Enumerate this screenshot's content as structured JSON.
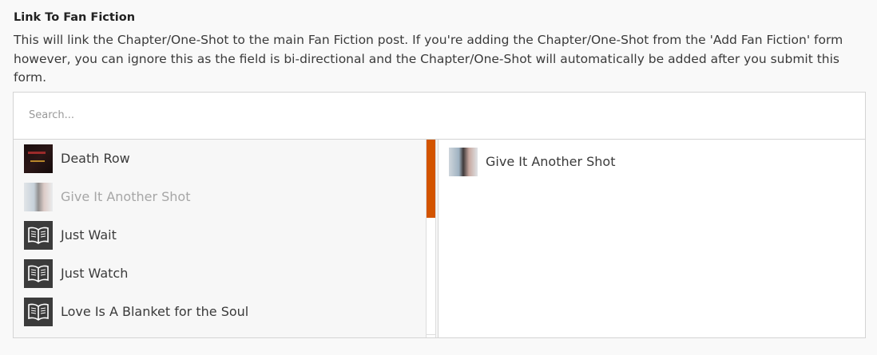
{
  "field": {
    "label": "Link To Fan Fiction",
    "description": "This will link the Chapter/One-Shot to the main Fan Fiction post. If you're adding the Chapter/One-Shot from the 'Add Fan Fiction' form however, you can ignore this as the field is bi-directional and the Chapter/One-Shot will automatically be added after you submit this form."
  },
  "search": {
    "placeholder": "Search..."
  },
  "choices": [
    {
      "label": "Death Row",
      "thumb": "dark-cover-image",
      "disabled": false
    },
    {
      "label": "Give It Another Shot",
      "thumb": "photo-cover-image",
      "disabled": true
    },
    {
      "label": "Just Wait",
      "thumb": "book-icon",
      "disabled": false
    },
    {
      "label": "Just Watch",
      "thumb": "book-icon",
      "disabled": false
    },
    {
      "label": "Love Is A Blanket for the Soul",
      "thumb": "book-icon",
      "disabled": false
    }
  ],
  "selected": [
    {
      "label": "Give It Another Shot",
      "thumb": "photo-cover-image"
    }
  ],
  "scrollbar": {
    "accent": "#d35400",
    "visible_fraction": 0.4
  }
}
